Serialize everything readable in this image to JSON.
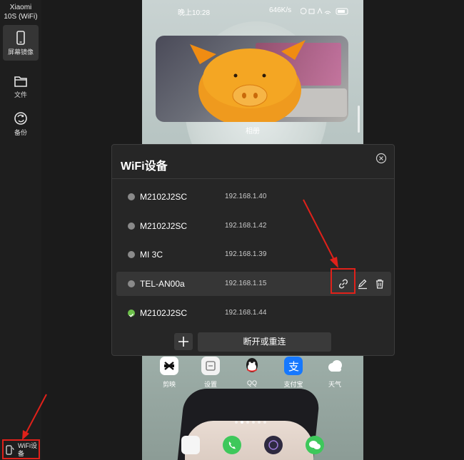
{
  "sidebar": {
    "device_name_line1": "Xiaomi",
    "device_name_line2": "10S (WiFi)",
    "items": [
      {
        "label": "屏幕镜像",
        "icon": "phone-icon",
        "active": true
      },
      {
        "label": "文件",
        "icon": "folder-icon",
        "active": false
      },
      {
        "label": "备份",
        "icon": "sync-icon",
        "active": false
      }
    ],
    "bottom_label": "WiFi设备",
    "bottom_icon": "phone-wifi-icon"
  },
  "phone": {
    "status_time": "晚上10:28",
    "status_speed": "646K/s",
    "widget_label": "相册",
    "apps": [
      {
        "label": "剪映",
        "icon": "capcut-icon",
        "color": "#ffffff"
      },
      {
        "label": "设置",
        "icon": "settings-icon",
        "color": "#f2f2f2"
      },
      {
        "label": "QQ",
        "icon": "qq-icon",
        "color": "#ffffff"
      },
      {
        "label": "支付宝",
        "icon": "alipay-icon",
        "color": "#1678ff"
      },
      {
        "label": "天气",
        "icon": "weather-icon",
        "color": "#9ec7e8"
      }
    ],
    "hotseat": [
      {
        "icon": "messages-icon",
        "color": "#f5f5f5"
      },
      {
        "icon": "phone-call-icon",
        "color": "#3ec85b"
      },
      {
        "icon": "camera-icon",
        "color": "#2e2a40"
      },
      {
        "icon": "wechat-icon",
        "color": "#3ec85b"
      }
    ]
  },
  "dialog": {
    "title": "WiFi设备",
    "devices": [
      {
        "name": "M2102J2SC",
        "ip": "192.168.1.40",
        "status": "offline"
      },
      {
        "name": "M2102J2SC",
        "ip": "192.168.1.42",
        "status": "offline"
      },
      {
        "name": "MI 3C",
        "ip": "192.168.1.39",
        "status": "offline"
      },
      {
        "name": "TEL-AN00a",
        "ip": "192.168.1.15",
        "status": "offline",
        "hovered": true
      },
      {
        "name": "M2102J2SC",
        "ip": "192.168.1.44",
        "status": "connected"
      }
    ],
    "add_label": "+",
    "disconnect_label": "断开或重连"
  },
  "colors": {
    "accent": "#1e90ff",
    "highlight": "#e0211a",
    "connected": "#6cc04a",
    "offline": "#8a8a8a"
  }
}
